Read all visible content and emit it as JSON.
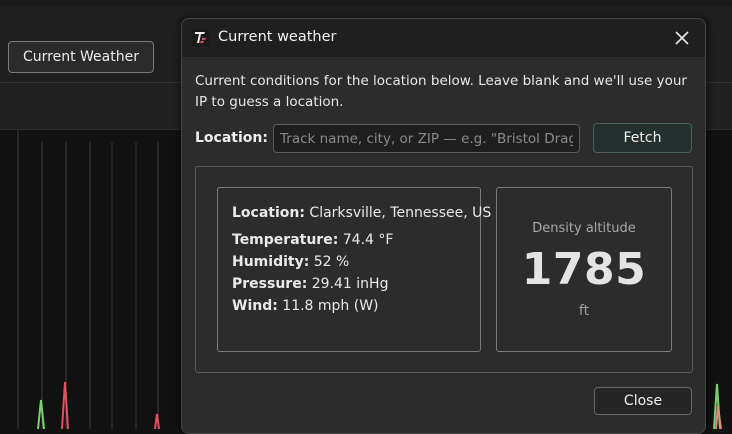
{
  "background": {
    "toolbar_button_label": "Current Weather"
  },
  "dialog": {
    "title": "Current weather",
    "description": "Current conditions for the location below. Leave blank and we'll use your IP to guess a location.",
    "location_label": "Location:",
    "location_placeholder": "Track name, city, or ZIP — e.g. \"Bristol Drag...",
    "location_value": "",
    "fetch_label": "Fetch",
    "close_label": "Close"
  },
  "weather": {
    "location_label": "Location:",
    "location_value": "Clarksville, Tennessee, US",
    "temperature_label": "Temperature:",
    "temperature_value": "74.4 °F",
    "humidity_label": "Humidity:",
    "humidity_value": "52 %",
    "pressure_label": "Pressure:",
    "pressure_value": "29.41 inHg",
    "wind_label": "Wind:",
    "wind_value": "11.8 mph (W)"
  },
  "density_altitude": {
    "label": "Density altitude",
    "value": "1785",
    "unit": "ft"
  },
  "icons": {
    "app": "app-logo-icon",
    "close": "close-icon"
  },
  "colors": {
    "chart_green": "#7bd16e",
    "chart_red": "#e0525e",
    "chart_orange": "#e08a7a"
  }
}
